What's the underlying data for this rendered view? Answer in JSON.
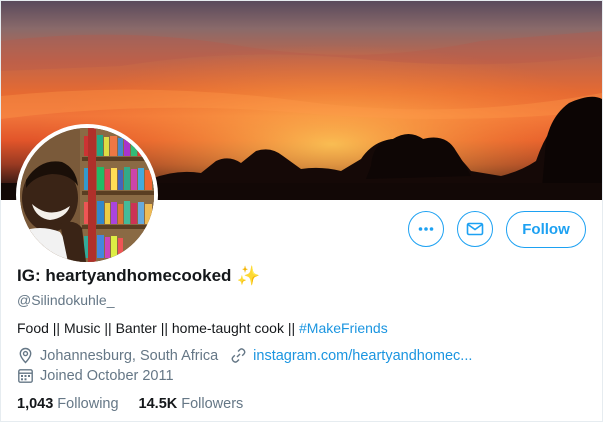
{
  "profile": {
    "name": "IG: heartyandhomecooked",
    "name_emoji": "✨",
    "handle": "@Silindokuhle_",
    "bio_text": "Food || Music || Banter || home-taught cook || ",
    "bio_hashtag": "#MakeFriends",
    "location": "Johannesburg, South Africa",
    "website": "instagram.com/heartyandhomec...",
    "joined": "Joined October 2011"
  },
  "actions": {
    "more_icon": "more-dots-icon",
    "message_icon": "envelope-icon",
    "follow_label": "Follow"
  },
  "stats": {
    "following_count": "1,043",
    "following_label": "Following",
    "followers_count": "14.5K",
    "followers_label": "Followers"
  },
  "colors": {
    "accent": "#1da1f2",
    "link": "#1b95e0",
    "secondary_text": "#657786",
    "primary_text": "#14171a"
  }
}
